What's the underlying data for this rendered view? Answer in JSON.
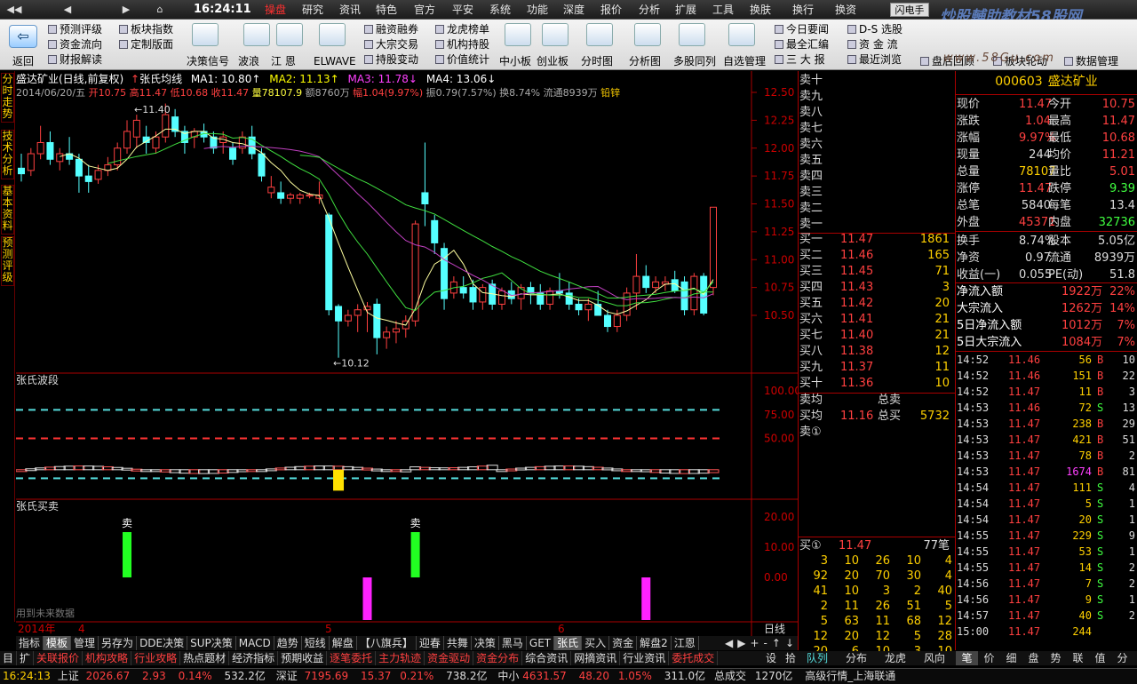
{
  "menubar": {
    "nav": [
      "◀◀",
      "◀",
      "▶",
      "⌂"
    ],
    "clock": "16:24:11",
    "items": [
      "操盘",
      "研究",
      "资讯",
      "特色",
      "官方",
      "平安",
      "系统",
      "功能",
      "深度",
      "报价",
      "分析",
      "扩展",
      "工具",
      "换肤",
      "换行",
      "换资"
    ],
    "active": 0,
    "flash_label": "闪电手"
  },
  "watermark": {
    "main": "炒股輔助教材58股网",
    "sub": "www.58Gu.com"
  },
  "toolbar": {
    "back": "返回",
    "left_links": [
      [
        "预测评级",
        "资金流向",
        "财报解读"
      ],
      [
        "板块指数",
        "定制版面"
      ]
    ],
    "icons": [
      "决策信号",
      "波浪",
      "江 恩",
      "ELWAVE"
    ],
    "mid_links": [
      [
        "融资融券",
        "大宗交易",
        "持股变动"
      ],
      [
        "龙虎榜单",
        "机构持股",
        "价值统计"
      ]
    ],
    "icons2": [
      "中小板",
      "创业板",
      "分时图",
      "分析图",
      "多股同列",
      "自选管理"
    ],
    "right_links": [
      [
        "今日要闻",
        "最全汇编",
        "三 大 报"
      ],
      [
        "D-S 选股",
        "资 金 流",
        "最近浏览"
      ]
    ],
    "far_right": [
      "盘后回顾",
      "板块轮动",
      "数据管理"
    ]
  },
  "leftnav": [
    "分时走势",
    "技术分析",
    "基本资料",
    "预测评级"
  ],
  "chart_header": {
    "title": "盛达矿业(日线,前复权)",
    "indicator": "张氏均线",
    "ma1": "MA1: 10.80↑",
    "ma2": "MA2: 11.13↑",
    "ma3": "MA3: 11.78↓",
    "ma4": "MA4: 13.06↓",
    "line2_date": "2014/06/20/五",
    "line2_open": "开10.75",
    "line2_high": "高11.47",
    "line2_low": "低10.68",
    "line2_close": "收11.47",
    "line2_vol": "量78107.9",
    "line2_amt": "额8760万",
    "line2_chg": "幅1.04(9.97%)",
    "line2_amp": "振0.79(7.57%)",
    "line2_turn": "换8.74%",
    "line2_float": "流通8939万",
    "line2_sector": "铅锌"
  },
  "chart_data": [
    {
      "type": "candlestick",
      "title": "盛达矿业(日线,前复权)",
      "ylim": [
        10.0,
        12.6
      ],
      "yticks": [
        "12.50",
        "12.25",
        "12.00",
        "11.75",
        "11.50",
        "11.25",
        "11.00",
        "10.75",
        "10.50"
      ],
      "annotations": [
        "11.40",
        "10.12"
      ],
      "series": [
        {
          "name": "MA1"
        },
        {
          "name": "MA2"
        },
        {
          "name": "MA3"
        },
        {
          "name": "MA4"
        }
      ],
      "candles": [
        [
          11.82,
          11.95,
          11.7,
          11.77
        ],
        [
          11.8,
          12.0,
          11.75,
          11.95
        ],
        [
          11.95,
          12.2,
          11.9,
          12.05
        ],
        [
          12.05,
          12.15,
          11.85,
          11.9
        ],
        [
          11.88,
          12.0,
          11.8,
          11.95
        ],
        [
          11.95,
          12.1,
          11.85,
          11.9
        ],
        [
          11.9,
          11.95,
          11.6,
          11.75
        ],
        [
          11.75,
          11.85,
          11.6,
          11.7
        ],
        [
          11.72,
          11.85,
          11.68,
          11.8
        ],
        [
          11.8,
          11.92,
          11.75,
          11.85
        ],
        [
          11.85,
          12.05,
          11.8,
          12.0
        ],
        [
          12.0,
          12.25,
          11.95,
          12.15
        ],
        [
          12.1,
          12.3,
          12.0,
          12.25
        ],
        [
          12.1,
          12.2,
          11.95,
          12.05
        ],
        [
          12.0,
          12.15,
          11.95,
          12.1
        ],
        [
          12.1,
          12.4,
          12.05,
          12.3
        ],
        [
          12.28,
          12.35,
          12.1,
          12.15
        ],
        [
          12.15,
          12.2,
          11.95,
          12.05
        ],
        [
          12.1,
          12.18,
          12.0,
          12.15
        ],
        [
          12.15,
          12.22,
          12.05,
          12.1
        ],
        [
          12.1,
          12.15,
          11.95,
          12.0
        ],
        [
          12.05,
          12.15,
          11.95,
          12.1
        ],
        [
          12.0,
          12.05,
          11.85,
          11.9
        ],
        [
          12.0,
          12.15,
          11.95,
          12.1
        ],
        [
          12.1,
          12.2,
          11.9,
          11.95
        ],
        [
          11.95,
          12.0,
          11.7,
          11.75
        ],
        [
          11.6,
          11.75,
          11.55,
          11.65
        ],
        [
          11.6,
          11.7,
          11.5,
          11.55
        ],
        [
          11.55,
          11.6,
          11.5,
          11.58
        ],
        [
          11.55,
          11.6,
          11.5,
          11.58
        ],
        [
          11.57,
          11.6,
          11.55,
          11.58
        ],
        [
          11.55,
          11.7,
          11.5,
          11.58
        ],
        [
          11.4,
          11.42,
          10.5,
          10.55
        ],
        [
          10.58,
          10.6,
          10.12,
          10.45
        ],
        [
          10.45,
          10.55,
          10.4,
          10.5
        ],
        [
          10.5,
          10.6,
          10.35,
          10.55
        ],
        [
          10.55,
          10.62,
          10.35,
          10.58
        ],
        [
          10.6,
          10.65,
          10.15,
          10.3
        ],
        [
          10.3,
          10.4,
          10.2,
          10.35
        ],
        [
          10.35,
          10.45,
          10.25,
          10.38
        ],
        [
          10.38,
          10.5,
          10.3,
          10.45
        ],
        [
          10.45,
          11.35,
          10.4,
          11.32
        ],
        [
          11.6,
          12.05,
          11.3,
          11.5
        ],
        [
          11.35,
          11.4,
          11.05,
          11.15
        ],
        [
          11.1,
          11.15,
          10.55,
          10.65
        ],
        [
          10.7,
          10.85,
          10.65,
          10.8
        ],
        [
          10.75,
          10.85,
          10.65,
          10.7
        ],
        [
          10.75,
          10.82,
          10.55,
          10.62
        ],
        [
          10.62,
          10.78,
          10.55,
          10.75
        ],
        [
          10.78,
          10.82,
          10.55,
          10.6
        ],
        [
          10.6,
          10.75,
          10.55,
          10.72
        ],
        [
          10.72,
          10.8,
          10.6,
          10.65
        ],
        [
          10.65,
          10.78,
          10.55,
          10.75
        ],
        [
          10.75,
          10.8,
          10.6,
          10.7
        ],
        [
          10.7,
          10.78,
          10.55,
          10.6
        ],
        [
          10.6,
          10.75,
          10.55,
          10.72
        ],
        [
          10.72,
          10.88,
          10.65,
          10.7
        ],
        [
          10.7,
          10.8,
          10.55,
          10.6
        ],
        [
          10.6,
          10.65,
          10.5,
          10.55
        ],
        [
          10.55,
          10.65,
          10.45,
          10.6
        ],
        [
          10.6,
          10.72,
          10.55,
          10.5
        ],
        [
          10.5,
          10.55,
          10.35,
          10.4
        ],
        [
          10.4,
          10.55,
          10.35,
          10.5
        ],
        [
          10.5,
          10.75,
          10.45,
          10.7
        ],
        [
          10.7,
          11.05,
          10.55,
          10.85
        ],
        [
          10.85,
          10.95,
          10.7,
          10.75
        ],
        [
          10.75,
          10.85,
          10.7,
          10.8
        ],
        [
          10.78,
          10.85,
          10.72,
          10.8
        ],
        [
          10.82,
          10.9,
          10.7,
          10.72
        ],
        [
          10.8,
          10.85,
          10.5,
          10.55
        ],
        [
          10.55,
          10.88,
          10.5,
          10.85
        ],
        [
          10.85,
          10.88,
          10.5,
          10.52
        ],
        [
          10.75,
          11.47,
          10.68,
          11.47
        ]
      ]
    },
    {
      "type": "line",
      "title": "张氏波段",
      "ylim": [
        0,
        110
      ],
      "yticks": [
        "100.00",
        "75.00",
        "50.00"
      ],
      "series": [
        {
          "name": "上轨",
          "color": "#5dd",
          "values": [
            80
          ]
        },
        {
          "name": "中轨",
          "color": "#f33",
          "values": [
            50
          ]
        }
      ]
    },
    {
      "type": "bar",
      "title": "张氏买卖",
      "ylim": [
        -30,
        25
      ],
      "yticks": [
        "20.00",
        "10.00",
        "0.00"
      ],
      "labels": [
        "卖",
        "卖"
      ],
      "note": "用到未来数据"
    }
  ],
  "xaxis": {
    "year": "2014年",
    "months": [
      "4",
      "5",
      "6"
    ],
    "period": "日线"
  },
  "orderbook": {
    "sells": [
      "卖十",
      "卖九",
      "卖八",
      "卖七",
      "卖六",
      "卖五",
      "卖四",
      "卖三",
      "卖二",
      "卖一"
    ],
    "buys": [
      {
        "label": "买一",
        "price": "11.47",
        "vol": "1861"
      },
      {
        "label": "买二",
        "price": "11.46",
        "vol": "165"
      },
      {
        "label": "买三",
        "price": "11.45",
        "vol": "71"
      },
      {
        "label": "买四",
        "price": "11.43",
        "vol": "3"
      },
      {
        "label": "买五",
        "price": "11.42",
        "vol": "20"
      },
      {
        "label": "买六",
        "price": "11.41",
        "vol": "21"
      },
      {
        "label": "买七",
        "price": "11.40",
        "vol": "21"
      },
      {
        "label": "买八",
        "price": "11.38",
        "vol": "12"
      },
      {
        "label": "买九",
        "price": "11.37",
        "vol": "11"
      },
      {
        "label": "买十",
        "price": "11.36",
        "vol": "10"
      }
    ],
    "avg_sell_label": "卖均",
    "avg_buy_label": "买均",
    "avg_buy": "11.16",
    "total_sell_label": "总卖",
    "total_buy_label": "总买",
    "total_buy": "5732",
    "sell1_label": "卖①",
    "buy1_label": "买①",
    "buy1_price": "11.47",
    "buy1_count": "77笔",
    "queue": [
      [
        "3",
        "10",
        "26",
        "10",
        "4"
      ],
      [
        "92",
        "20",
        "70",
        "30",
        "4"
      ],
      [
        "41",
        "10",
        "3",
        "2",
        "40"
      ],
      [
        "2",
        "11",
        "26",
        "51",
        "5"
      ],
      [
        "5",
        "63",
        "11",
        "68",
        "12"
      ],
      [
        "12",
        "20",
        "12",
        "5",
        "28"
      ],
      [
        "20",
        "6",
        "10",
        "3",
        "10"
      ]
    ]
  },
  "quote": {
    "code": "000603",
    "name": "盛达矿业",
    "rows": [
      [
        "现价",
        "11.47",
        "今开",
        "10.75"
      ],
      [
        "涨跌",
        "1.04",
        "最高",
        "11.47"
      ],
      [
        "涨幅",
        "9.97%",
        "最低",
        "10.68"
      ],
      [
        "现量",
        "244",
        "均价",
        "11.21"
      ],
      [
        "总量",
        "78107",
        "量比",
        "5.01"
      ],
      [
        "涨停",
        "11.47",
        "跌停",
        "9.39"
      ],
      [
        "总笔",
        "5840",
        "每笔",
        "13.4"
      ],
      [
        "外盘",
        "45371",
        "内盘",
        "32736"
      ],
      [
        "换手",
        "8.74%",
        "股本",
        "5.05亿"
      ],
      [
        "净资",
        "0.97",
        "流通",
        "8939万"
      ],
      [
        "收益(一)",
        "0.055",
        "PE(动)",
        "51.8"
      ]
    ],
    "flows": [
      [
        "净流入额",
        "1922万",
        "22%"
      ],
      [
        "大宗流入",
        "1262万",
        "14%"
      ],
      [
        "5日净流入额",
        "1012万",
        "7%"
      ],
      [
        "5日大宗流入",
        "1084万",
        "7%"
      ]
    ]
  },
  "ticks": [
    [
      "14:52",
      "11.46",
      "56",
      "B",
      "10"
    ],
    [
      "14:52",
      "11.46",
      "151",
      "B",
      "22"
    ],
    [
      "14:52",
      "11.47",
      "11",
      "B",
      "3"
    ],
    [
      "14:53",
      "11.46",
      "72",
      "S",
      "13"
    ],
    [
      "14:53",
      "11.47",
      "238",
      "B",
      "29"
    ],
    [
      "14:53",
      "11.47",
      "421",
      "B",
      "51"
    ],
    [
      "14:53",
      "11.47",
      "78",
      "B",
      "2"
    ],
    [
      "14:53",
      "11.47",
      "1674",
      "B",
      "81"
    ],
    [
      "14:54",
      "11.47",
      "111",
      "S",
      "4"
    ],
    [
      "14:54",
      "11.47",
      "5",
      "S",
      "1"
    ],
    [
      "14:54",
      "11.47",
      "20",
      "S",
      "1"
    ],
    [
      "14:55",
      "11.47",
      "229",
      "S",
      "9"
    ],
    [
      "14:55",
      "11.47",
      "53",
      "S",
      "1"
    ],
    [
      "14:55",
      "11.47",
      "14",
      "S",
      "2"
    ],
    [
      "14:56",
      "11.47",
      "7",
      "S",
      "2"
    ],
    [
      "14:56",
      "11.47",
      "9",
      "S",
      "1"
    ],
    [
      "14:57",
      "11.47",
      "40",
      "S",
      "2"
    ],
    [
      "15:00",
      "11.47",
      "244",
      "",
      ""
    ]
  ],
  "indicator_tabs": [
    "指标",
    "模板",
    "管理",
    "另存为",
    "DDE决策",
    "SUP决策",
    "MACD",
    "趋势",
    "短线",
    "解盘",
    "【八旗兵】",
    "迎春",
    "共舞",
    "决策",
    "黑马",
    "GET",
    "张氏",
    "买入",
    "资金",
    "解盘2",
    "江恩"
  ],
  "indicator_tabs_selected": [
    1,
    16
  ],
  "indicator_nav": [
    "◀",
    "▶",
    "+",
    "-",
    "↑",
    "↓"
  ],
  "bottom_tabs": [
    "目",
    "扩",
    "关联报价",
    "机构攻略",
    "行业攻略",
    "热点题材",
    "经济指标",
    "预期收益",
    "逐笔委托",
    "主力轨迹",
    "资金驱动",
    "资金分布",
    "综合资讯",
    "网摘资讯",
    "行业资讯",
    "委托成交"
  ],
  "bottom_nav": [
    "设",
    "拾"
  ],
  "right_tabs1": [
    "队列",
    "分布",
    "龙虎",
    "风向"
  ],
  "right_tabs2": [
    "笔",
    "价",
    "细",
    "盘",
    "势",
    "联",
    "值",
    "分"
  ],
  "status": {
    "time": "16:24:13",
    "sh_label": "上证",
    "sh": "2026.67",
    "sh_chg": "2.93",
    "sh_pct": "0.14%",
    "sh_amt": "532.2亿",
    "sz_label": "深证",
    "sz": "7195.69",
    "sz_chg": "15.37",
    "sz_pct": "0.21%",
    "sz_amt": "738.2亿",
    "zx_label": "中小",
    "zx": "4631.57",
    "zx_chg": "48.20",
    "zx_pct": "1.05%",
    "zx_amt": "311.0亿",
    "total_label": "总成交",
    "total": "1270亿",
    "conn": "高级行情_上海联通"
  }
}
